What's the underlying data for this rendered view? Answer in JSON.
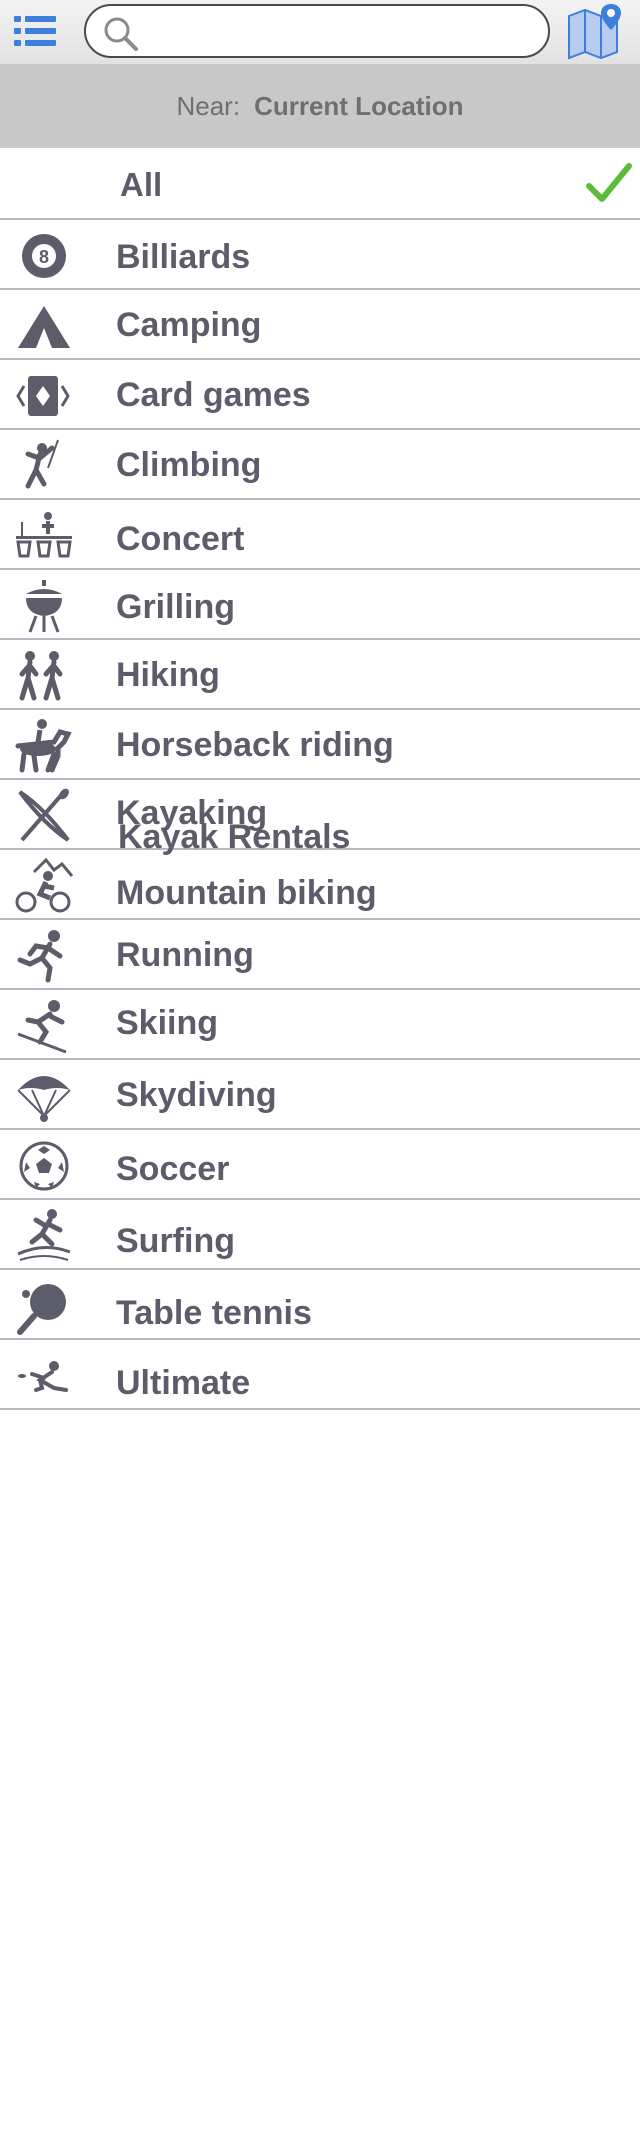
{
  "search": {
    "placeholder": "",
    "value": ""
  },
  "near": {
    "label": "Near:",
    "value": "Current Location"
  },
  "all_item": {
    "label": "All",
    "selected": true
  },
  "activities": [
    {
      "label": "Billiards",
      "icon": "billiards-8-ball-icon"
    },
    {
      "label": "Camping",
      "icon": "tent-icon"
    },
    {
      "label": "Card games",
      "icon": "playing-cards-icon"
    },
    {
      "label": "Climbing",
      "icon": "climber-icon"
    },
    {
      "label": "Concert",
      "icon": "concert-stage-icon"
    },
    {
      "label": "Grilling",
      "icon": "grill-icon"
    },
    {
      "label": "Hiking",
      "icon": "hikers-icon"
    },
    {
      "label": "Horseback riding",
      "icon": "horse-rider-icon"
    },
    {
      "label": "Kayaking",
      "icon": "kayak-paddle-icon"
    },
    {
      "label": "Kayak Rentals",
      "icon": ""
    },
    {
      "label": "Mountain biking",
      "icon": "mountain-biker-icon"
    },
    {
      "label": "Running",
      "icon": "runner-icon"
    },
    {
      "label": "Skiing",
      "icon": "skier-icon"
    },
    {
      "label": "Skydiving",
      "icon": "parachute-icon"
    },
    {
      "label": "Soccer",
      "icon": "soccer-ball-icon"
    },
    {
      "label": "Surfing",
      "icon": "surfer-icon"
    },
    {
      "label": "Table tennis",
      "icon": "ping-pong-paddle-icon"
    },
    {
      "label": "Ultimate",
      "icon": "ultimate-frisbee-icon"
    }
  ],
  "colors": {
    "icon_gray": "#5d5c6a",
    "toolbar_blue": "#3f7fdc",
    "check_green": "#5cbc3a",
    "near_bar_bg": "#c8c8c8",
    "separator": "#b8b8c2"
  }
}
